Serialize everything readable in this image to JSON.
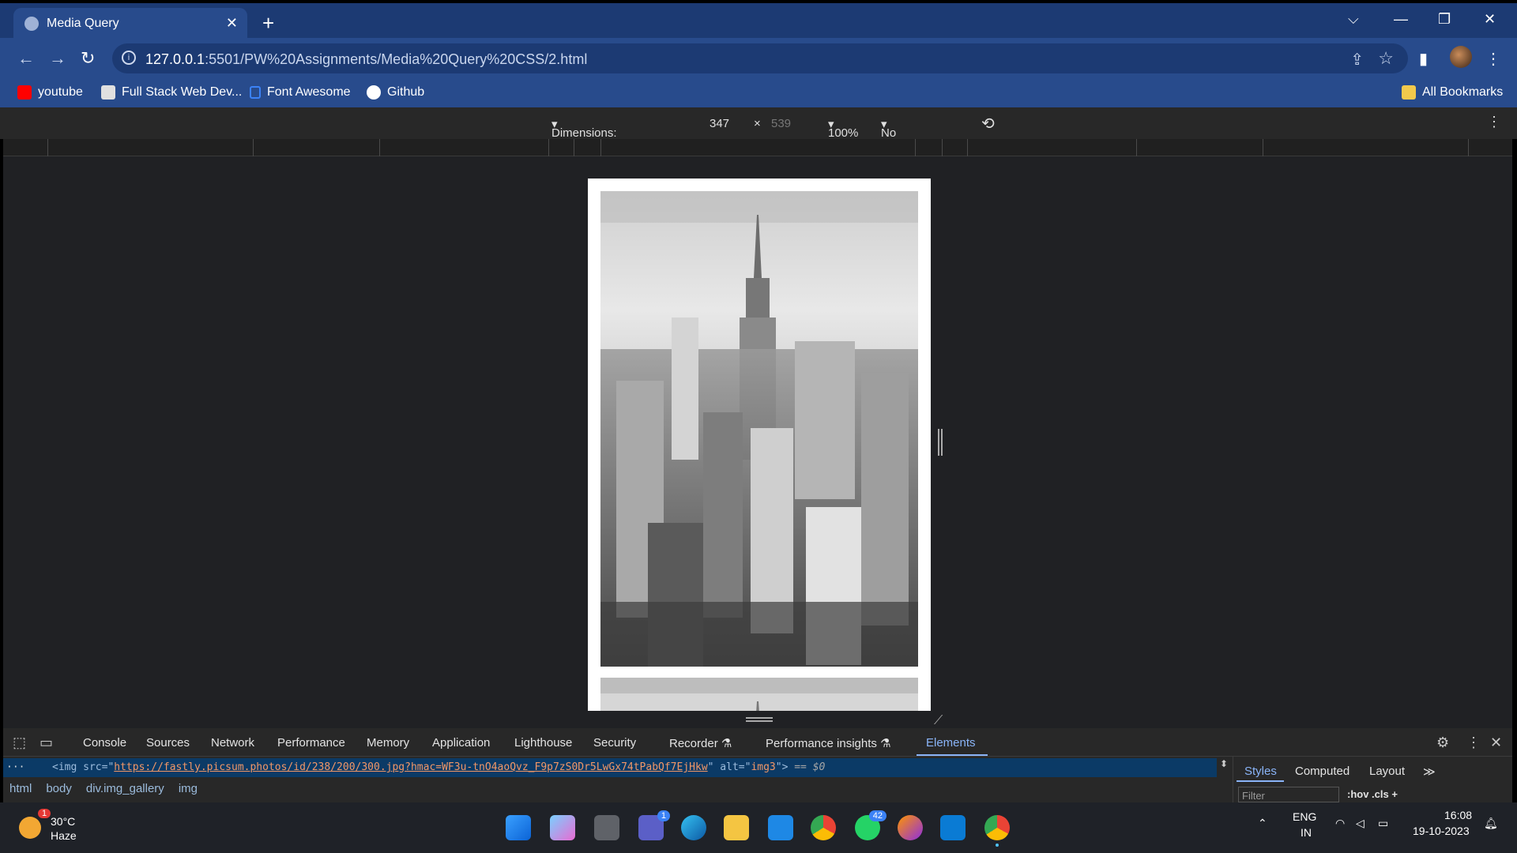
{
  "browser": {
    "tab_title": "Media Query",
    "url_host": "127.0.0.1",
    "url_path": ":5501/PW%20Assignments/Media%20Query%20CSS/2.html"
  },
  "bookmarks": [
    {
      "label": "youtube",
      "icon": "youtube-icon",
      "color": "#ff0000"
    },
    {
      "label": "Full Stack Web Dev...",
      "icon": "book-icon",
      "color": "#e0e0e0"
    },
    {
      "label": "Font Awesome",
      "icon": "flag-icon",
      "color": "#3b82f6"
    },
    {
      "label": "Github",
      "icon": "github-icon",
      "color": "#ffffff"
    }
  ],
  "all_bookmarks": "All Bookmarks",
  "device_toolbar": {
    "dimensions": "Dimensions: Responsive",
    "width": "347",
    "times": "×",
    "height": "539",
    "zoom": "100%",
    "throttling": "No throttling"
  },
  "devtools": {
    "tabs": [
      "Console",
      "Sources",
      "Network",
      "Performance",
      "Memory",
      "Application",
      "Lighthouse",
      "Security",
      "Recorder",
      "Performance insights",
      "Elements"
    ],
    "active_tab": "Elements",
    "code": {
      "open": "<img src=\"",
      "src": "https://fastly.picsum.photos/id/238/200/300.jpg?hmac=WF3u-tnO4aoQvz_F9p7zS0Dr5LwGx74tPabQf7EjHkw",
      "mid": "\" alt=\"",
      "alt": "img3",
      "close": "\">",
      "suffix": " == $0"
    },
    "breadcrumbs": [
      "html",
      "body",
      "div.img_gallery",
      "img"
    ],
    "styles_tabs": [
      "Styles",
      "Computed",
      "Layout"
    ],
    "filter_placeholder": "Filter",
    "styles_tools": ":hov  .cls  +"
  },
  "taskbar": {
    "weather_temp": "30°C",
    "weather_cond": "Haze",
    "weather_badge": "1",
    "teams_badge": "1",
    "whatsapp_badge": "42",
    "lang_top": "ENG",
    "lang_bottom": "IN",
    "time": "16:08",
    "date": "19-10-2023"
  },
  "colors": {
    "tab_strip": "#1c3a73",
    "toolbar": "#284b8c",
    "devtools_bg": "#282828",
    "accent": "#8ab4f8"
  }
}
